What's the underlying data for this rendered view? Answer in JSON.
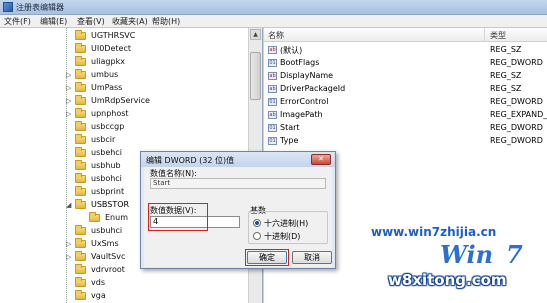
{
  "window": {
    "title": "注册表编辑器"
  },
  "menu": [
    "文件(F)",
    "编辑(E)",
    "查看(V)",
    "收藏夹(A)",
    "帮助(H)"
  ],
  "tree": {
    "items": [
      {
        "label": "UGTHRSVC",
        "expander": ""
      },
      {
        "label": "UI0Detect",
        "expander": ""
      },
      {
        "label": "uliagpkx",
        "expander": ""
      },
      {
        "label": "umbus",
        "expander": "▷"
      },
      {
        "label": "UmPass",
        "expander": "▷"
      },
      {
        "label": "UmRdpService",
        "expander": "▷"
      },
      {
        "label": "upnphost",
        "expander": "▷"
      },
      {
        "label": "usbccgp",
        "expander": ""
      },
      {
        "label": "usbcir",
        "expander": ""
      },
      {
        "label": "usbehci",
        "expander": ""
      },
      {
        "label": "usbhub",
        "expander": ""
      },
      {
        "label": "usbohci",
        "expander": ""
      },
      {
        "label": "usbprint",
        "expander": ""
      },
      {
        "label": "USBSTOR",
        "expander": "◢"
      },
      {
        "label": "Enum",
        "expander": ""
      },
      {
        "label": "usbuhci",
        "expander": ""
      },
      {
        "label": "UxSms",
        "expander": "▷"
      },
      {
        "label": "VaultSvc",
        "expander": "▷"
      },
      {
        "label": "vdrvroot",
        "expander": ""
      },
      {
        "label": "vds",
        "expander": ""
      },
      {
        "label": "vga",
        "expander": ""
      }
    ]
  },
  "values": {
    "headers": {
      "name": "名称",
      "type": "类型"
    },
    "rows": [
      {
        "icon": "ab",
        "name": "(默认)",
        "type": "REG_SZ"
      },
      {
        "icon": "01",
        "name": "BootFlags",
        "type": "REG_DWORD"
      },
      {
        "icon": "ab",
        "name": "DisplayName",
        "type": "REG_SZ"
      },
      {
        "icon": "ab",
        "name": "DriverPackageId",
        "type": "REG_SZ"
      },
      {
        "icon": "01",
        "name": "ErrorControl",
        "type": "REG_DWORD"
      },
      {
        "icon": "ab",
        "name": "ImagePath",
        "type": "REG_EXPAND_S"
      },
      {
        "icon": "01",
        "name": "Start",
        "type": "REG_DWORD"
      },
      {
        "icon": "01",
        "name": "Type",
        "type": "REG_DWORD"
      }
    ]
  },
  "dialog": {
    "title": "编辑 DWORD (32 位)值",
    "close_glyph": "✕",
    "name_label": "数值名称(N):",
    "name_value": "Start",
    "data_label": "数值数据(V):",
    "data_value": "4",
    "base_label": "基数",
    "radio_hex": "十六进制(H)",
    "radio_dec": "十进制(D)",
    "ok_label": "确定",
    "cancel_label": "取消"
  },
  "watermark": {
    "site": "www.win7zhijia.cn",
    "logo_text": "Win",
    "logo_suffix": "7",
    "bottom": "w8xitong.com"
  },
  "colors": {
    "highlight": "#d62020",
    "accent": "#1d5ec8"
  },
  "icons": {
    "folder": "folder-icon",
    "close": "close-icon",
    "string_value": "string-value-icon",
    "dword_value": "dword-value-icon"
  }
}
